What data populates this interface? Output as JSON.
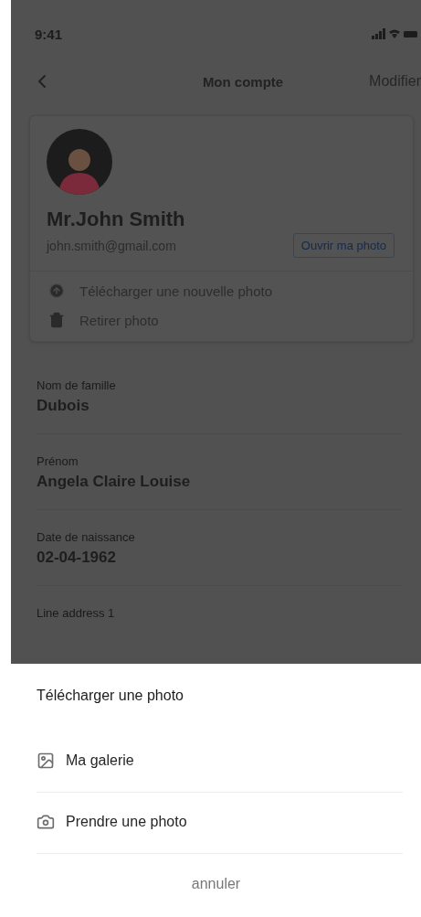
{
  "status_bar": {
    "time": "9:41"
  },
  "nav": {
    "title": "Mon compte",
    "action": "Modifier"
  },
  "profile": {
    "name": "Mr.John Smith",
    "email": "john.smith@gmail.com",
    "button": "Ouvrir ma photo",
    "actions": [
      {
        "kind": "upload",
        "label": "Télécharger une nouvelle photo"
      },
      {
        "kind": "delete",
        "label": "Retirer photo"
      }
    ]
  },
  "fields": [
    {
      "label": "Nom de famille",
      "value": "Dubois"
    },
    {
      "label": "Prénom",
      "value": "Angela Claire Louise"
    },
    {
      "label": "Date de naissance",
      "value": "02-04-1962"
    },
    {
      "label": "Line address 1"
    }
  ],
  "sheet": {
    "title": "Télécharger une photo",
    "options": [
      {
        "kind": "gallery",
        "label": "Ma galerie"
      },
      {
        "kind": "camera",
        "label": "Prendre une photo"
      }
    ],
    "cancel": "annuler"
  }
}
